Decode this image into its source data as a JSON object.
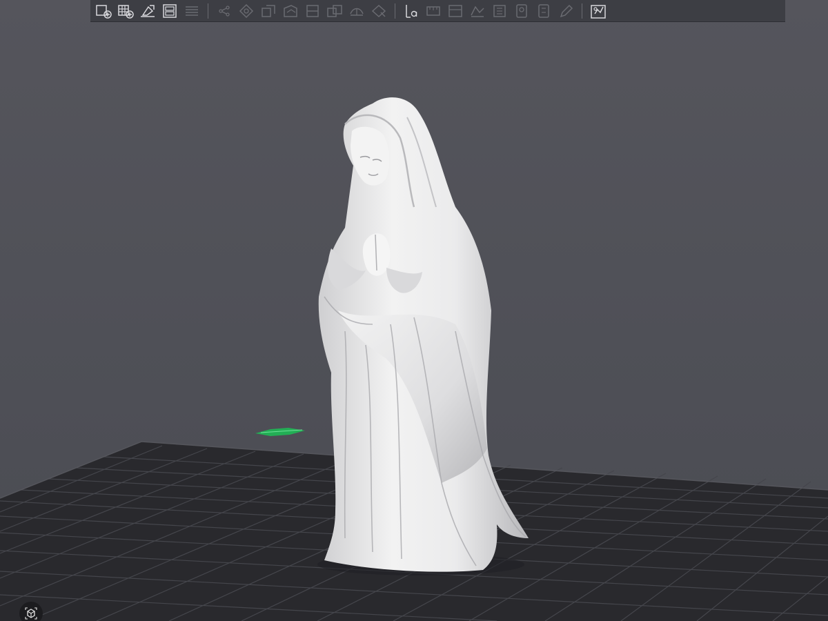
{
  "toolbar": {
    "buttons": [
      {
        "name": "add-plate-icon",
        "state": "enabled"
      },
      {
        "name": "arrange-grid-icon",
        "state": "enabled"
      },
      {
        "name": "orient-icon",
        "state": "enabled"
      },
      {
        "name": "split-layout-icon",
        "state": "enabled"
      },
      {
        "name": "layers-icon",
        "state": "disabled"
      },
      {
        "name": "move-icon",
        "state": "disabled"
      },
      {
        "name": "rotate-icon",
        "state": "disabled"
      },
      {
        "name": "scale-icon",
        "state": "disabled"
      },
      {
        "name": "lay-on-face-icon",
        "state": "disabled"
      },
      {
        "name": "cut-icon",
        "state": "disabled"
      },
      {
        "name": "mesh-boolean-icon",
        "state": "disabled"
      },
      {
        "name": "support-paint-icon",
        "state": "disabled"
      },
      {
        "name": "seam-paint-icon",
        "state": "disabled"
      },
      {
        "name": "text-emboss-icon",
        "state": "disabled"
      },
      {
        "name": "measure-icon",
        "state": "disabled"
      },
      {
        "name": "assembly-icon",
        "state": "disabled"
      },
      {
        "name": "variable-layer-icon",
        "state": "disabled"
      },
      {
        "name": "fuzzy-skin-icon",
        "state": "disabled"
      },
      {
        "name": "color-paint-icon",
        "state": "disabled"
      },
      {
        "name": "brim-ears-icon",
        "state": "disabled"
      },
      {
        "name": "pen-icon",
        "state": "disabled"
      },
      {
        "name": "slice-view-icon",
        "state": "enabled"
      }
    ]
  },
  "bed": {
    "label": "",
    "grid_color": "#3b3c42",
    "bed_color": "#2a2b2f"
  },
  "colors": {
    "background": "#4f5058",
    "model": "#e6e6e6",
    "axis_marker": "#22c25a"
  }
}
